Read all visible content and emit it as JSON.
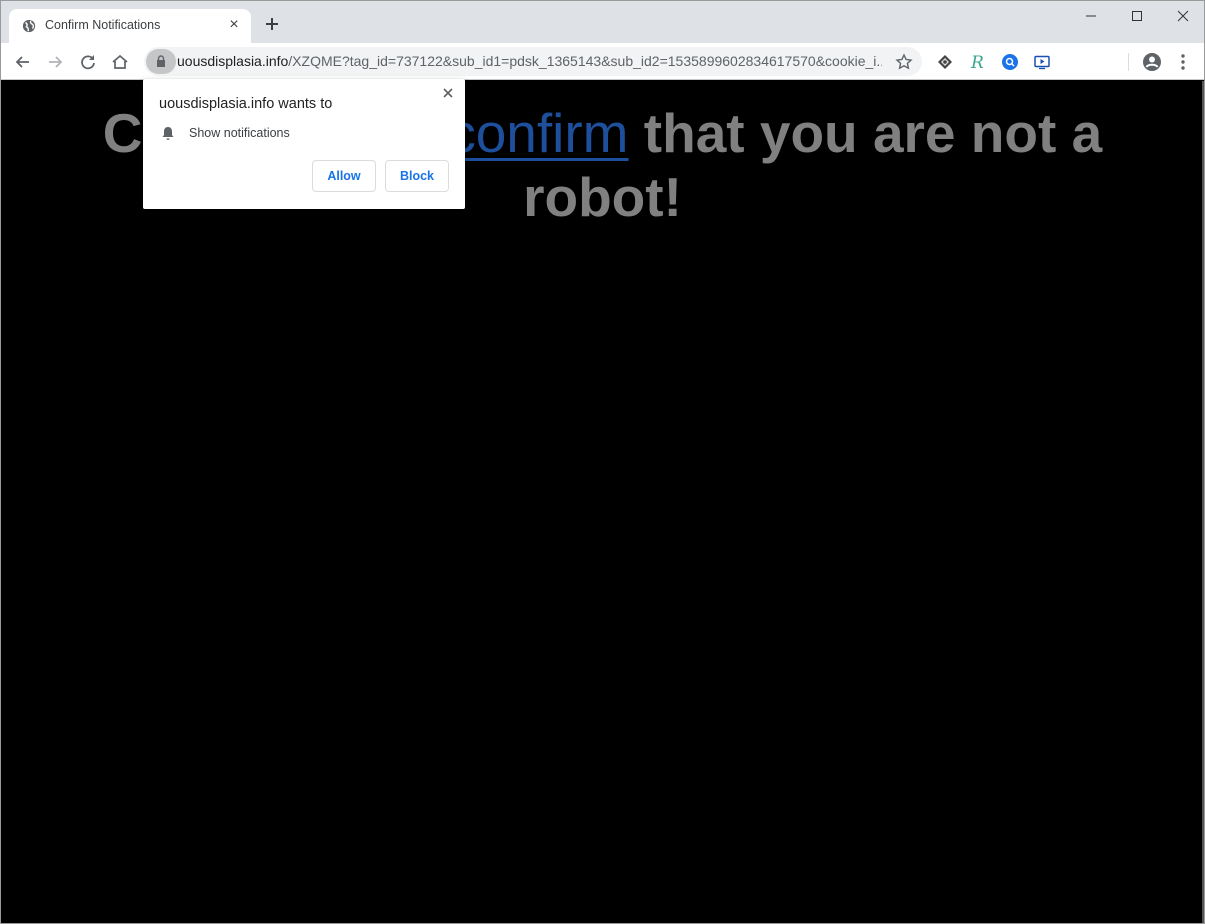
{
  "browser": {
    "tab": {
      "title": "Confirm Notifications",
      "favicon": "globe-icon",
      "close_icon": "×"
    },
    "new_tab_icon": "plus-icon",
    "window_controls": [
      "minimize-icon",
      "maximize-icon",
      "close-icon"
    ],
    "address_bar": {
      "host": "uousdisplasia.info",
      "path": "/XZQME?tag_id=737122&sub_id1=pdsk_1365143&sub_id2=1535899602834617570&cookie_i...",
      "security_icon": "lock-icon",
      "bookmark_icon": "star-icon"
    },
    "extensions": [
      "diamond-extension-icon",
      "r-extension-icon",
      "search-extension-icon",
      "media-extension-icon"
    ],
    "profile_icon": "account-icon",
    "menu_icon": "kebab-menu-icon"
  },
  "page": {
    "headline_before": "Click here to",
    "headline_link": "confirm",
    "headline_after": "that you are not a robot!",
    "background": "#000000",
    "text_color": "#808080",
    "link_color": "#1d4f9c"
  },
  "permission_popup": {
    "title": "uousdisplasia.info wants to",
    "permission": "Show notifications",
    "allow_label": "Allow",
    "block_label": "Block",
    "accent": "#1a73e8"
  }
}
